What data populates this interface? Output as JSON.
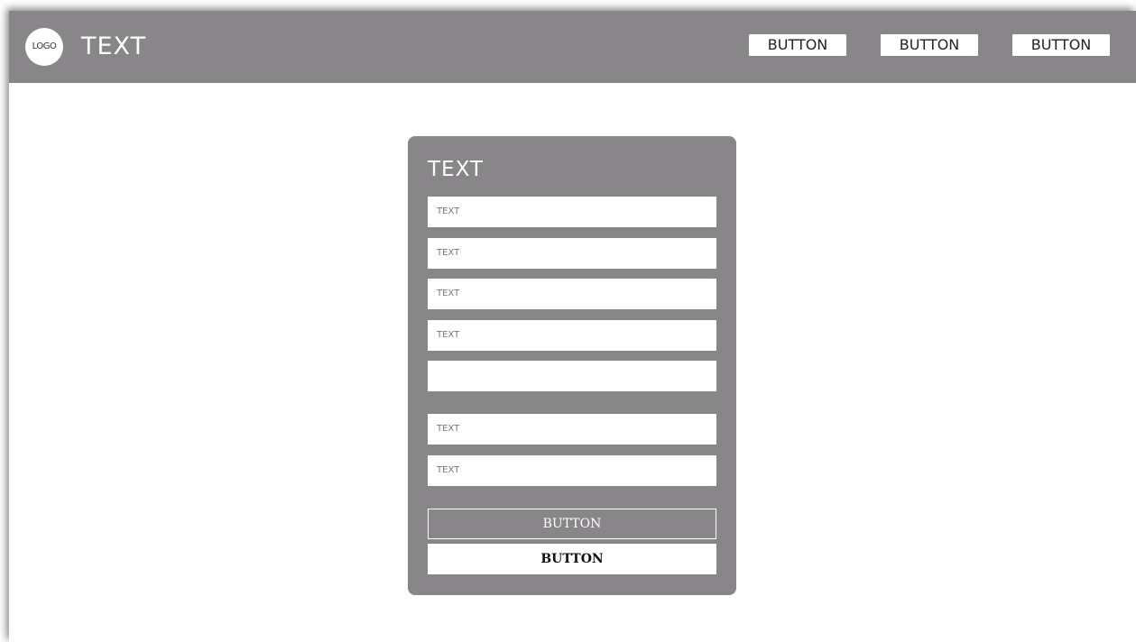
{
  "header": {
    "logo_text": "LOGO",
    "title": "TEXT",
    "nav_buttons": [
      "BUTTON",
      "BUTTON",
      "BUTTON"
    ],
    "background": "#888688"
  },
  "form": {
    "title": "TEXT",
    "fields": [
      {
        "text": "TEXT"
      },
      {
        "text": "TEXT"
      },
      {
        "text": "TEXT"
      },
      {
        "text": "TEXT"
      },
      {
        "text": ""
      },
      {
        "text": "TEXT"
      },
      {
        "text": "TEXT"
      }
    ],
    "primary_button": "BUTTON",
    "secondary_button": "BUTTON",
    "background": "#888688"
  }
}
